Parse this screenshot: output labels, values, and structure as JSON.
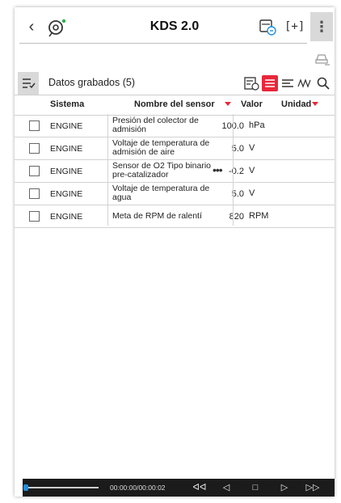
{
  "header": {
    "title": "KDS 2.0",
    "back_icon": "chevron-left-icon",
    "more_label": "⋮",
    "fullscreen_label": "[+]"
  },
  "toolbar": {
    "recorded_label": "Datos grabados (5)",
    "active_color": "#e8273a"
  },
  "table": {
    "columns": {
      "sistema": "Sistema",
      "nombre": "Nombre del sensor",
      "valor": "Valor",
      "unidad": "Unidad"
    },
    "rows": [
      {
        "system": "ENGINE",
        "name": "Presión del colector de admisión",
        "value": "100.0",
        "unit": "hPa"
      },
      {
        "system": "ENGINE",
        "name": "Voltaje de temperatura de admisión de aire",
        "value": "5.0",
        "unit": "V"
      },
      {
        "system": "ENGINE",
        "name": "Sensor de O2 Tipo binario pre-catalizador",
        "value": "-0.2",
        "unit": "V",
        "more": "•••"
      },
      {
        "system": "ENGINE",
        "name": "Voltaje de temperatura de agua",
        "value": "5.0",
        "unit": "V"
      },
      {
        "system": "ENGINE",
        "name": "Meta de RPM de ralentí",
        "value": "820",
        "unit": "RPM"
      }
    ]
  },
  "player": {
    "time": "00:00:00/00:00:02",
    "progress": 0.0,
    "rewind_label": "ᐊᐊ",
    "prev_label": "◁",
    "stop_label": "□",
    "next_label": "▷",
    "ff_label": "▷▷",
    "thumb_color": "#1e8fe0"
  }
}
